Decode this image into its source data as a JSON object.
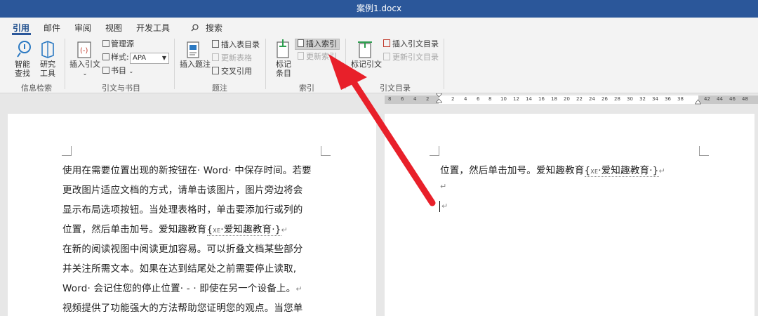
{
  "title": "案例1.docx",
  "tabs": [
    "引用",
    "邮件",
    "审阅",
    "视图",
    "开发工具"
  ],
  "search_label": "搜索",
  "ribbon": {
    "smart_lookup": [
      "智能",
      "查找"
    ],
    "researcher": [
      "研究",
      "工具"
    ],
    "insert_citation": "插入引文",
    "manage_sources": "管理源",
    "style_label": "样式:",
    "style_value": "APA",
    "bibliography": "书目",
    "insert_caption": "插入题注",
    "insert_toc_figures": "插入表目录",
    "update_table": "更新表格",
    "cross_reference": "交叉引用",
    "mark_entry": [
      "标记",
      "条目"
    ],
    "insert_index": "插入索引",
    "update_index": "更新索引",
    "mark_citation": "标记引文",
    "insert_toa": "插入引文目录",
    "update_toa": "更新引文目录",
    "groups": {
      "research": "信息检索",
      "citations": "引文与书目",
      "captions": "题注",
      "index": "索引",
      "toa": "引文目录"
    }
  },
  "ruler_ticks": [
    "8",
    "6",
    "4",
    "2",
    "2",
    "4",
    "6",
    "8",
    "10",
    "12",
    "14",
    "16",
    "18",
    "20",
    "22",
    "24",
    "26",
    "28",
    "30",
    "32",
    "34",
    "36",
    "38",
    "42",
    "44",
    "46",
    "48"
  ],
  "document": {
    "page1_lines": [
      "使用在需要位置出现的新按钮在· Word· 中保存时间。若要",
      "更改图片适应文档的方式，请单击该图片，图片旁边将会",
      "显示布局选项按钮。当处理表格时，单击要添加行或列的",
      "位置，然后单击加号。爱知趣教育",
      "在新的阅读视图中阅读更加容易。可以折叠文档某些部分",
      "并关注所需文本。如果在达到结尾处之前需要停止读取,",
      "Word· 会记住您的停止位置· - · 即使在另一个设备上。",
      "视频提供了功能强大的方法帮助您证明您的观点。当您单"
    ],
    "page2_line": "位置，然后单击加号。爱知趣教育",
    "xe_field": "XE",
    "xe_text": "爱知趣教育·",
    "return_mark": "↵"
  }
}
